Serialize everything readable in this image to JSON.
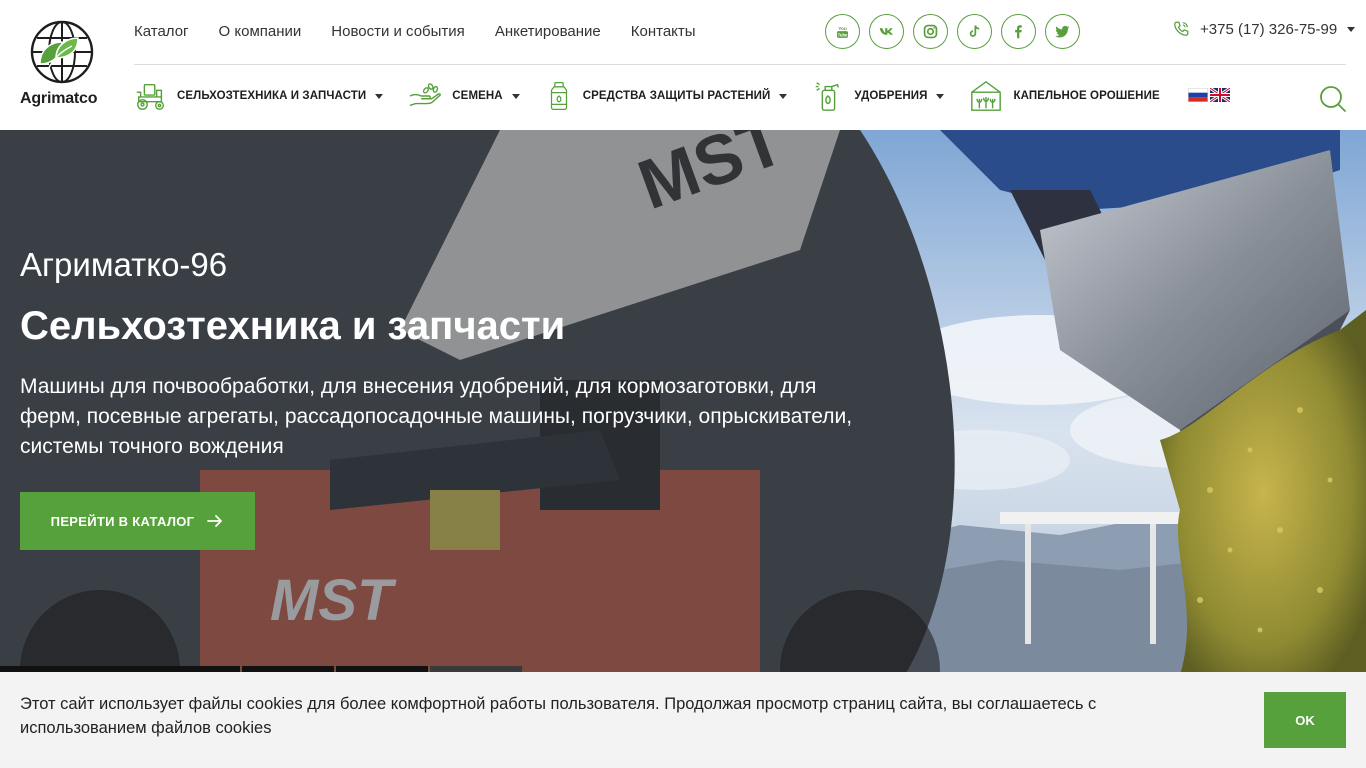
{
  "brand": {
    "name": "Agrimatco"
  },
  "top_nav": [
    {
      "label": "Каталог"
    },
    {
      "label": "О компании"
    },
    {
      "label": "Новости и события"
    },
    {
      "label": "Анкетирование"
    },
    {
      "label": "Контакты"
    }
  ],
  "socials": [
    "youtube-icon",
    "vk-icon",
    "instagram-icon",
    "tiktok-icon",
    "facebook-icon",
    "twitter-icon"
  ],
  "phone": {
    "number": "+375 (17) 326-75-99"
  },
  "categories": [
    {
      "label": "Сельхозтехника и запчасти",
      "icon": "tractor-icon"
    },
    {
      "label": "Семена",
      "icon": "seeds-hand-icon"
    },
    {
      "label": "Средства защиты растений",
      "icon": "bottle-icon"
    },
    {
      "label": "Удобрения",
      "icon": "sprayer-icon"
    },
    {
      "label": "Капельное орошение",
      "icon": "greenhouse-icon"
    }
  ],
  "languages": [
    "ru-flag-icon",
    "en-flag-icon"
  ],
  "hero": {
    "kicker": "Агриматко-96",
    "title": "Сельхозтехника и запчасти",
    "description": "Машины для почвообработки, для внесения удобрений, для кормозаготовки, для ферм, посевные агрегаты, рассадопосадочные машины, погрузчики, опрыскиватели, системы точного вождения",
    "cta_label": "Перейти в каталог",
    "slide_count": 4
  },
  "cookie": {
    "text": "Этот сайт использует файлы cookies для более комфортной работы пользователя. Продолжая просмотр страниц сайта, вы соглашаетесь с использованием файлов cookies",
    "ok_label": "OK"
  },
  "colors": {
    "accent": "#56a13b",
    "dark_text": "#1e1e1e",
    "cookie_bg": "#f3f3f3"
  }
}
